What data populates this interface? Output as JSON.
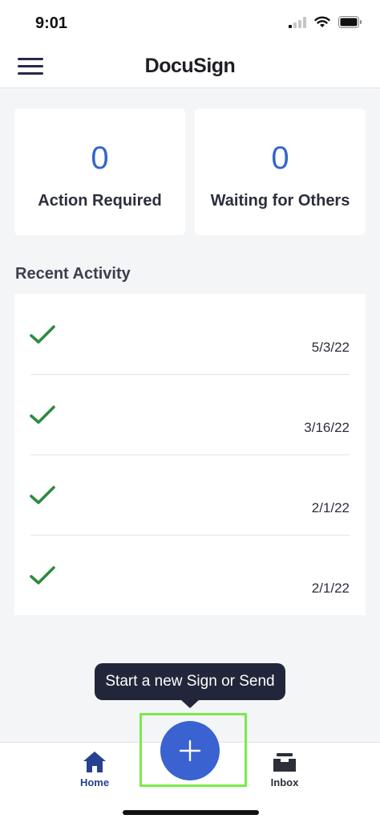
{
  "status_bar": {
    "time": "9:01"
  },
  "header": {
    "brand": "DocuSign"
  },
  "summary": {
    "action_required": {
      "count": "0",
      "label": "Action Required"
    },
    "waiting_for_others": {
      "count": "0",
      "label": "Waiting for Others"
    }
  },
  "recent_activity": {
    "title": "Recent Activity",
    "items": [
      {
        "status_icon": "check-icon",
        "date": "5/3/22"
      },
      {
        "status_icon": "check-icon",
        "date": "3/16/22"
      },
      {
        "status_icon": "check-icon",
        "date": "2/1/22"
      },
      {
        "status_icon": "check-icon",
        "date": "2/1/22"
      }
    ]
  },
  "tooltip": {
    "text": "Start a new Sign or Send"
  },
  "tab_bar": {
    "home_label": "Home",
    "inbox_label": "Inbox"
  },
  "colors": {
    "accent": "#3a62d0",
    "check": "#2e8b3e",
    "tooltip_bg": "#22263a",
    "highlight": "#7bea4a"
  }
}
